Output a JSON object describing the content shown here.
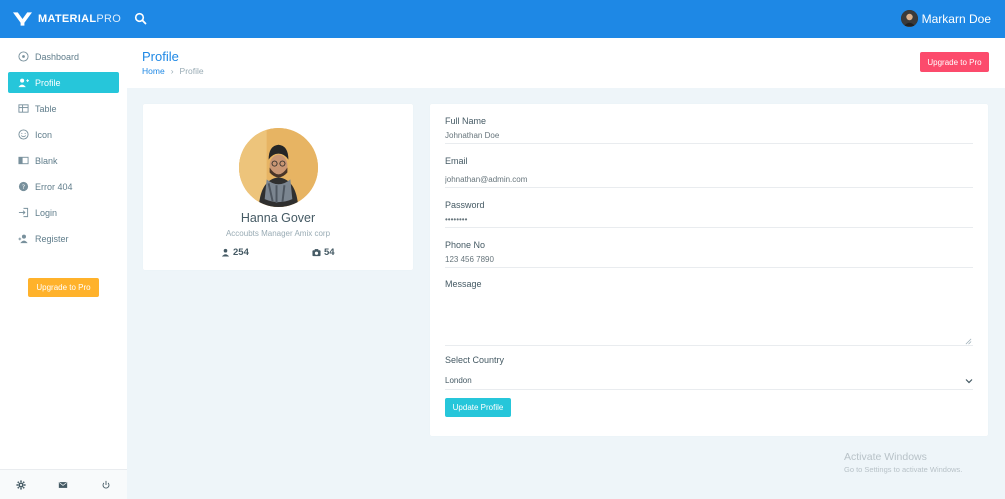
{
  "brand": {
    "name_bold": "MATERIAL",
    "name_light": "PRO"
  },
  "topbar": {
    "user_name": "Markarn Doe"
  },
  "sidebar": {
    "items": [
      {
        "label": "Dashboard",
        "icon": "gauge-icon"
      },
      {
        "label": "Profile",
        "icon": "user-plus-icon",
        "active": true
      },
      {
        "label": "Table",
        "icon": "table-icon"
      },
      {
        "label": "Icon",
        "icon": "smile-icon"
      },
      {
        "label": "Blank",
        "icon": "columns-icon"
      },
      {
        "label": "Error 404",
        "icon": "help-circle-icon"
      },
      {
        "label": "Login",
        "icon": "login-icon"
      },
      {
        "label": "Register",
        "icon": "user-add-icon"
      }
    ],
    "upgrade_label": "Upgrade to Pro",
    "footer_icons": [
      "gear-icon",
      "mail-icon",
      "power-icon"
    ]
  },
  "page": {
    "title": "Profile",
    "breadcrumb": {
      "home": "Home",
      "separator": "›",
      "current": "Profile"
    },
    "upgrade_label": "Upgrade to Pro"
  },
  "profile": {
    "name": "Hanna Gover",
    "role": "Accoubts Manager Amix corp",
    "followers": "254",
    "photos": "54"
  },
  "form": {
    "full_name_label": "Full Name",
    "full_name_value": "Johnathan Doe",
    "email_label": "Email",
    "email_value": "johnathan@admin.com",
    "password_label": "Password",
    "password_value": "password",
    "phone_label": "Phone No",
    "phone_value": "123 456 7890",
    "message_label": "Message",
    "message_value": "",
    "country_label": "Select Country",
    "country_value": "London",
    "submit_label": "Update Profile"
  },
  "watermark": {
    "title": "Activate Windows",
    "subtitle": "Go to Settings to activate Windows."
  },
  "colors": {
    "topbar": "#1e88e5",
    "active_nav": "#26c6da",
    "upgrade_side": "#ffb22b",
    "upgrade_top": "#fc4b6c",
    "primary_button": "#26c6da"
  }
}
